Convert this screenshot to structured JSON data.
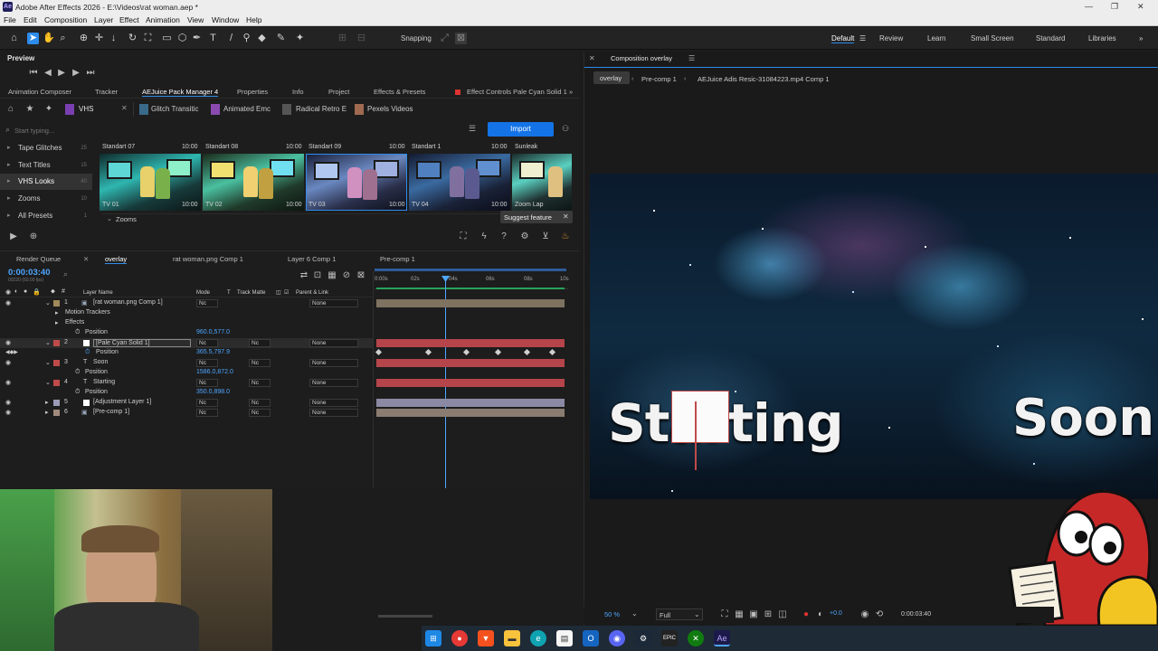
{
  "window": {
    "title": "Adobe After Effects 2026 - E:\\Videos\\rat woman.aep *",
    "logo": "Ae"
  },
  "menu": [
    "File",
    "Edit",
    "Composition",
    "Layer",
    "Effect",
    "Animation",
    "View",
    "Window",
    "Help"
  ],
  "toolbar": {
    "snapping_label": "Snapping",
    "workspaces": [
      "Default",
      "Review",
      "Learn",
      "Small Screen",
      "Standard",
      "Libraries"
    ],
    "active_workspace": "Default"
  },
  "preview": {
    "title": "Preview"
  },
  "panel_tabs": [
    "Animation Composer",
    "Tracker",
    "AEJuice Pack Manager 4",
    "Properties",
    "Info",
    "Project",
    "Effects & Presets",
    "Effect Controls Pale Cyan Solid 1"
  ],
  "aejuice": {
    "category": "VHS",
    "packs": [
      "Glitch Transitic",
      "Animated Emc",
      "Radical Retro E",
      "Pexels Videos"
    ],
    "search_placeholder": "Start typing...",
    "import_label": "Import",
    "categories": [
      {
        "name": "Tape Glitches",
        "count": "25"
      },
      {
        "name": "Text Titles",
        "count": "15"
      },
      {
        "name": "VHS Looks",
        "count": "40"
      },
      {
        "name": "Zooms",
        "count": "10"
      },
      {
        "name": "All Presets",
        "count": "1"
      }
    ],
    "thumbnails": [
      {
        "top": "Standart 07",
        "time_top": "10:00",
        "bottom": "TV 01",
        "time_bottom": "10:00"
      },
      {
        "top": "Standart 08",
        "time_top": "10:00",
        "bottom": "TV 02",
        "time_bottom": "10:00"
      },
      {
        "top": "Standart 09",
        "time_top": "10:00",
        "bottom": "TV 03",
        "time_bottom": "10:00"
      },
      {
        "top": "Standart 1",
        "time_top": "10:00",
        "bottom": "TV 04",
        "time_bottom": "10:00"
      },
      {
        "top": "Sunleak",
        "time_top": "",
        "bottom": "Zoom Lap",
        "time_bottom": ""
      }
    ],
    "group_label": "Zooms",
    "suggest_label": "Suggest feature"
  },
  "timeline": {
    "tabs": [
      "Render Queue",
      "overlay",
      "rat woman.png Comp 1",
      "Layer 6 Comp 1",
      "Pre-comp 1"
    ],
    "active_tab": "overlay",
    "timecode": "0:00:03:40",
    "fps": "00220 (60.00 fps)",
    "columns": {
      "layer_name": "Layer Name",
      "mode": "Mode",
      "t": "T",
      "track_matte": "Track Matte",
      "parent": "Parent & Link"
    },
    "ruler": [
      "0:00s",
      "02s",
      "04s",
      "06s",
      "08s",
      "10s"
    ],
    "rows": [
      {
        "num": "1",
        "name": "[rat woman.png Comp 1]",
        "mode": "Nc",
        "matte": "",
        "parent": "None",
        "color": "#a08a5c",
        "kind": "layer"
      },
      {
        "name": "Motion Trackers",
        "kind": "group"
      },
      {
        "name": "Effects",
        "kind": "group"
      },
      {
        "name": "Position",
        "value": "960.0,577.0",
        "kind": "prop"
      },
      {
        "num": "2",
        "name": "[Pale Cyan Solid 1]",
        "mode": "Nc",
        "matte": "Nc",
        "parent": "None",
        "color": "#c04a4a",
        "kind": "layer"
      },
      {
        "name": "Position",
        "value": "365.5,797.9",
        "kind": "prop"
      },
      {
        "num": "3",
        "name": "Soon",
        "mode": "Nc",
        "matte": "Nc",
        "parent": "None",
        "color": "#c04a4a",
        "kind": "layer"
      },
      {
        "name": "Position",
        "value": "1586.0,872.0",
        "kind": "prop"
      },
      {
        "num": "4",
        "name": "Starting",
        "mode": "Nc",
        "matte": "Nc",
        "parent": "None",
        "color": "#c04a4a",
        "kind": "layer"
      },
      {
        "name": "Position",
        "value": "350.0,898.0",
        "kind": "prop"
      },
      {
        "num": "5",
        "name": "[Adjustment Layer 1]",
        "mode": "Nc",
        "matte": "Nc",
        "parent": "None",
        "color": "#9c9cb8",
        "kind": "layer"
      },
      {
        "num": "6",
        "name": "[Pre-comp 1]",
        "mode": "Nc",
        "matte": "Nc",
        "parent": "None",
        "color": "#a08a7c",
        "kind": "layer"
      }
    ]
  },
  "composition": {
    "title": "Composition overlay",
    "breadcrumbs": [
      "overlay",
      "Pre-comp 1",
      "AEJuice Adis Resic-31084223.mp4 Comp 1"
    ],
    "text_left": "Starting",
    "text_right": "Soon",
    "zoom": "50 %",
    "resolution": "Full",
    "exposure": "+0.0",
    "timecode": "0:00:03:40"
  },
  "colors": {
    "accent": "#2d8ceb",
    "playhead": "#4ea6ff",
    "layer_red": "#b5454a",
    "import_btn": "#1473e6"
  }
}
